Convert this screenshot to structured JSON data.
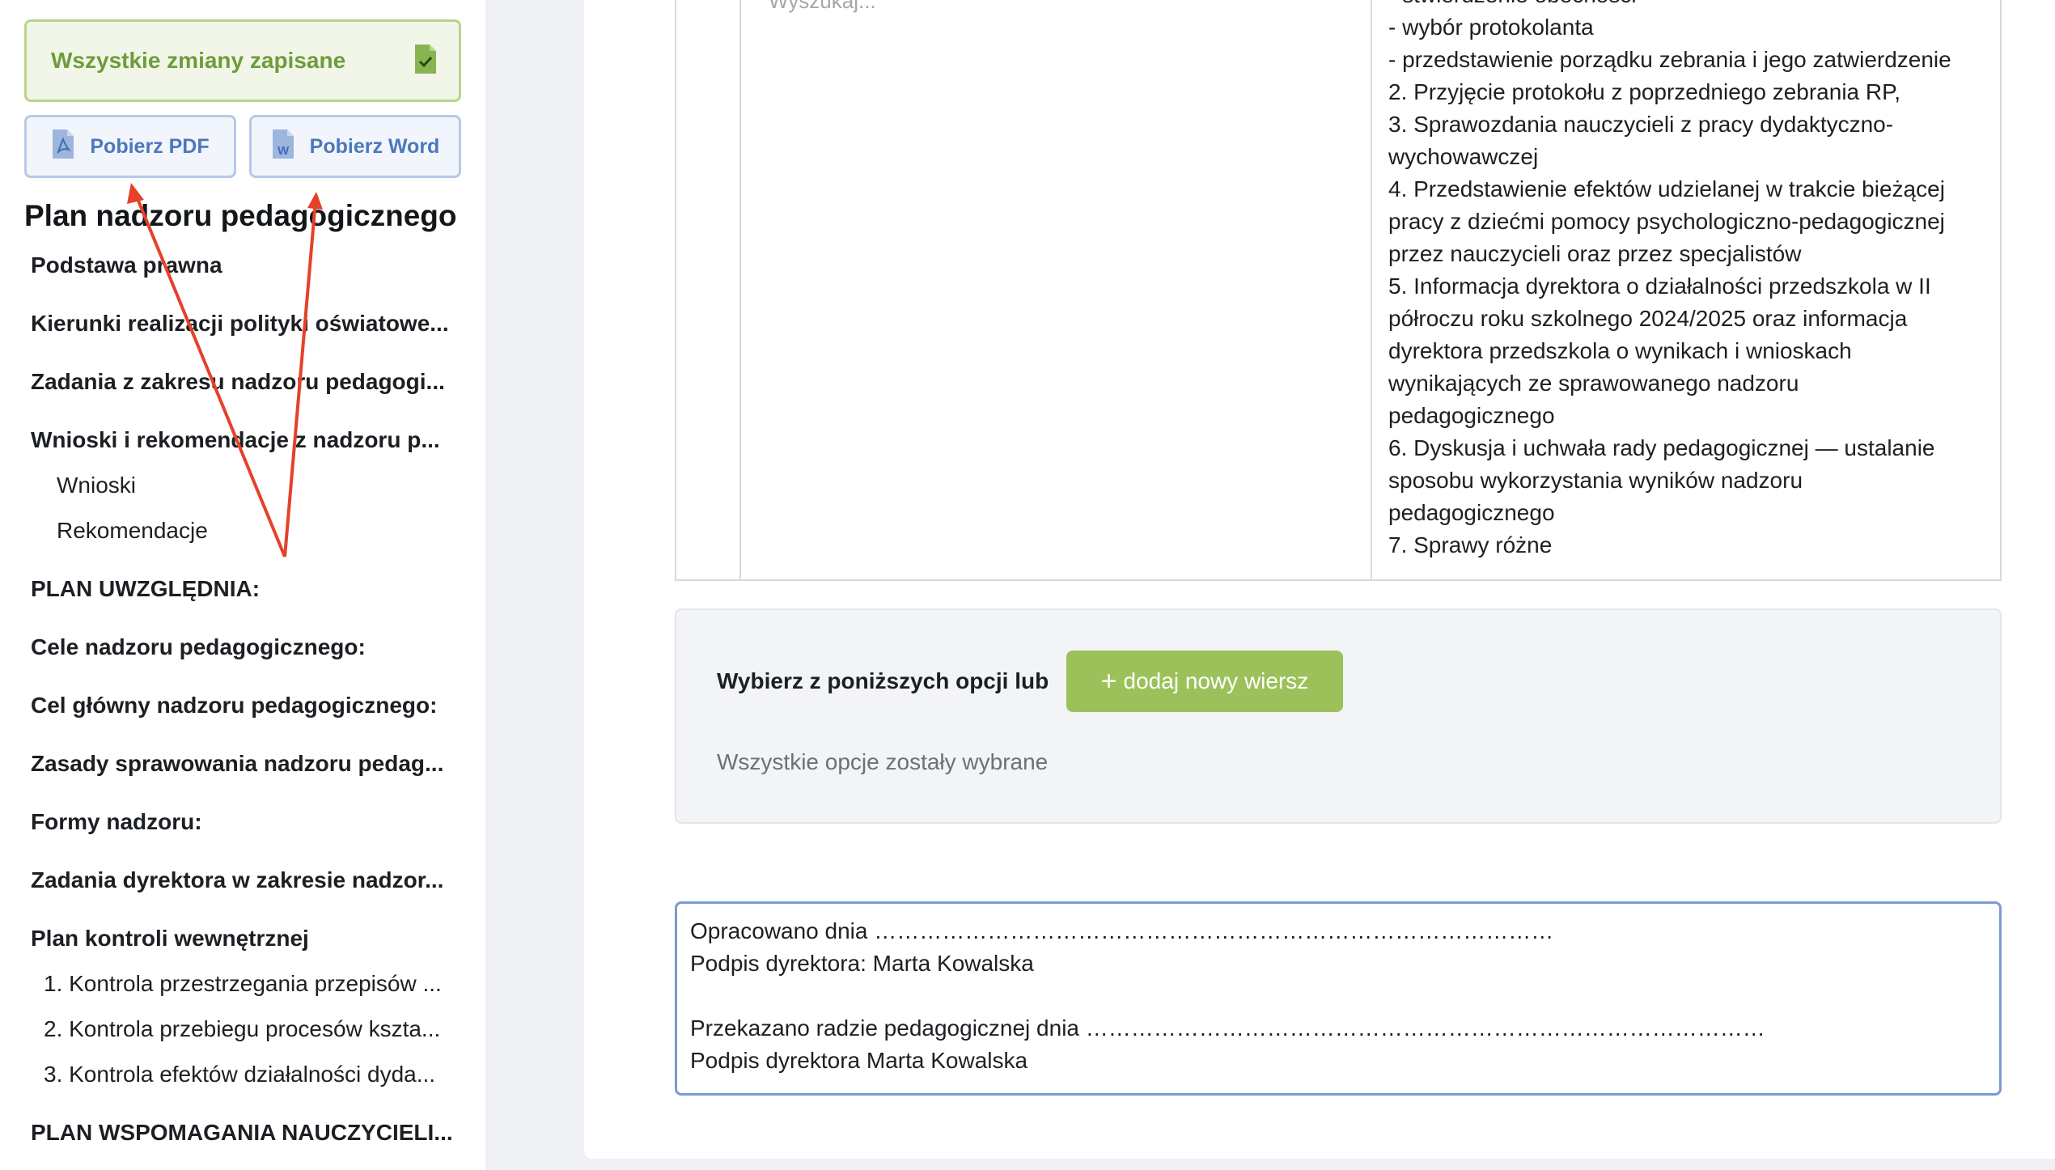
{
  "sidebar": {
    "saved_status": "Wszystkie zmiany zapisane",
    "download_pdf": "Pobierz PDF",
    "download_word": "Pobierz Word",
    "title": "Plan nadzoru pedagogicznego",
    "nav": [
      "Podstawa prawna",
      "Kierunki realizacji polityki oświatowe...",
      "Zadania z zakresu nadzoru pedagogi...",
      "Wnioski i rekomendacje z nadzoru p...",
      "Wnioski",
      "Rekomendacje",
      "PLAN UWZGLĘDNIA:",
      "Cele nadzoru pedagogicznego:",
      "Cel główny nadzoru pedagogicznego:",
      "Zasady sprawowania nadzoru pedag...",
      "Formy nadzoru:",
      "Zadania dyrektora w zakresie nadzor...",
      "Plan kontroli wewnętrznej",
      "1. Kontrola przestrzegania przepisów ...",
      "2. Kontrola przebiegu procesów kszta...",
      "3. Kontrola efektów działalności dyda...",
      "PLAN WSPOMAGANIA NAUCZYCIELI..."
    ]
  },
  "table": {
    "search_placeholder": "Wyszukaj...",
    "agenda_lines": [
      "- stwierdzenie obecności",
      "- wybór protokolanta",
      "- przedstawienie porządku zebrania i jego zatwierdzenie",
      "2. Przyjęcie protokołu z poprzedniego zebrania RP,",
      "3. Sprawozdania nauczycieli z pracy dydaktyczno-",
      "wychowawczej",
      "4. Przedstawienie efektów udzielanej w trakcie bieżącej",
      "pracy z dziećmi pomocy psychologiczno-pedagogicznej",
      "przez nauczycieli oraz przez specjalistów",
      "5. Informacja dyrektora o działalności przedszkola w II",
      "półroczu roku szkolnego 2024/2025 oraz informacja",
      "dyrektora przedszkola o wynikach i wnioskach",
      "wynikających ze sprawowanego nadzoru",
      "pedagogicznego",
      "6. Dyskusja i  uchwała rady pedagogicznej — ustalanie",
      "sposobu wykorzystania wyników nadzoru",
      "pedagogicznego",
      "7. Sprawy różne"
    ]
  },
  "options": {
    "label": "Wybierz z poniższych opcji lub",
    "add_button": "dodaj nowy wiersz",
    "add_icon": "+",
    "message": "Wszystkie opcje zostały wybrane"
  },
  "footer": {
    "lines": [
      "Opracowano dnia ………………………………………………………………………………",
      "Podpis dyrektora: Marta Kowalska",
      "",
      "Przekazano radzie pedagogicznej dnia ………………………………………………………………………………",
      "Podpis dyrektora Marta Kowalska"
    ]
  },
  "colors": {
    "saved_green": "#6e9c3a",
    "download_blue": "#4b78bd",
    "add_button_bg": "#9cc15a",
    "annotation_arrow": "#e5412b"
  }
}
